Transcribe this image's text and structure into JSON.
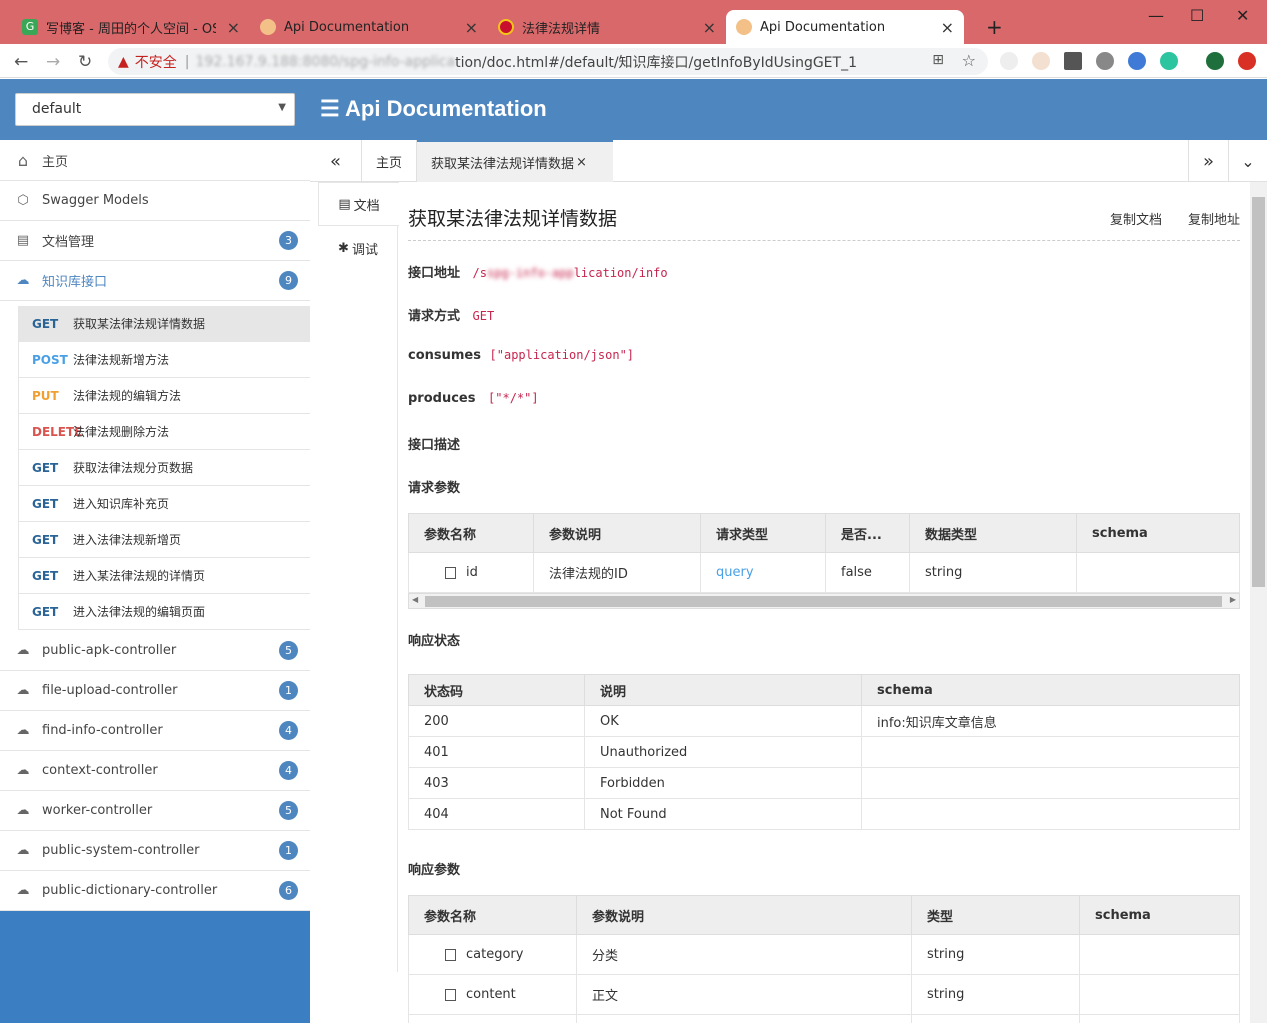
{
  "browser": {
    "tabs": [
      {
        "title": "写博客 - 周田的个人空间 - OSCH"
      },
      {
        "title": "Api Documentation"
      },
      {
        "title": "法律法规详情"
      },
      {
        "title": "Api Documentation"
      }
    ],
    "new_tab": "+",
    "insecure_label": "不安全",
    "url_host": "192.167.9.188:8080/spg-info-applica",
    "url_path": "tion/doc.html#/default/知识库接口/getInfoByIdUsingGET_1"
  },
  "header": {
    "group_select": "default",
    "title": "Api Documentation"
  },
  "sidebar": {
    "home": "主页",
    "models": "Swagger Models",
    "docs": {
      "label": "文档管理",
      "count": "3"
    },
    "knowledge": {
      "label": "知识库接口",
      "count": "9"
    },
    "endpoints": [
      {
        "method": "GET",
        "label": "获取某法律法规详情数据"
      },
      {
        "method": "POST",
        "label": "法律法规新增方法"
      },
      {
        "method": "PUT",
        "label": "法律法规的编辑方法"
      },
      {
        "method": "DELETE",
        "label": "法律法规删除方法"
      },
      {
        "method": "GET",
        "label": "获取法律法规分页数据"
      },
      {
        "method": "GET",
        "label": "进入知识库补充页"
      },
      {
        "method": "GET",
        "label": "进入法律法规新增页"
      },
      {
        "method": "GET",
        "label": "进入某法律法规的详情页"
      },
      {
        "method": "GET",
        "label": "进入法律法规的编辑页面"
      }
    ],
    "controllers": [
      {
        "label": "public-apk-controller",
        "count": "5"
      },
      {
        "label": "file-upload-controller",
        "count": "1"
      },
      {
        "label": "find-info-controller",
        "count": "4"
      },
      {
        "label": "context-controller",
        "count": "4"
      },
      {
        "label": "worker-controller",
        "count": "5"
      },
      {
        "label": "public-system-controller",
        "count": "1"
      },
      {
        "label": "public-dictionary-controller",
        "count": "6"
      }
    ]
  },
  "content_tabs": {
    "prev": "«",
    "home": "主页",
    "active": "获取某法律法规详情数据",
    "next": "»"
  },
  "side_tabs": {
    "doc": "文档",
    "debug": "调试"
  },
  "doc": {
    "title": "获取某法律法规详情数据",
    "copy_doc": "复制文档",
    "copy_url": "复制地址",
    "address_label": "接口地址",
    "address_value_hidden": "spg-info-app",
    "address_value_suffix": "lication/info",
    "method_label": "请求方式",
    "method_value": "GET",
    "consumes_label": "consumes",
    "consumes_value": "[\"application/json\"]",
    "produces_label": "produces",
    "produces_value": "[\"*/*\"]",
    "desc_label": "接口描述",
    "req_params_label": "请求参数",
    "resp_status_label": "响应状态",
    "resp_params_label": "响应参数"
  },
  "req_table": {
    "headers": [
      "参数名称",
      "参数说明",
      "请求类型",
      "是否...",
      "数据类型",
      "schema"
    ],
    "rows": [
      {
        "name": "id",
        "desc": "法律法规的ID",
        "in": "query",
        "required": "false",
        "type": "string",
        "schema": ""
      }
    ]
  },
  "status_table": {
    "headers": [
      "状态码",
      "说明",
      "schema"
    ],
    "rows": [
      {
        "code": "200",
        "desc": "OK",
        "schema": "info:知识库文章信息"
      },
      {
        "code": "401",
        "desc": "Unauthorized",
        "schema": ""
      },
      {
        "code": "403",
        "desc": "Forbidden",
        "schema": ""
      },
      {
        "code": "404",
        "desc": "Not Found",
        "schema": ""
      }
    ]
  },
  "resp_table": {
    "headers": [
      "参数名称",
      "参数说明",
      "类型",
      "schema"
    ],
    "rows": [
      {
        "name": "category",
        "desc": "分类",
        "type": "string",
        "schema": ""
      },
      {
        "name": "content",
        "desc": "正文",
        "type": "string",
        "schema": ""
      }
    ]
  }
}
